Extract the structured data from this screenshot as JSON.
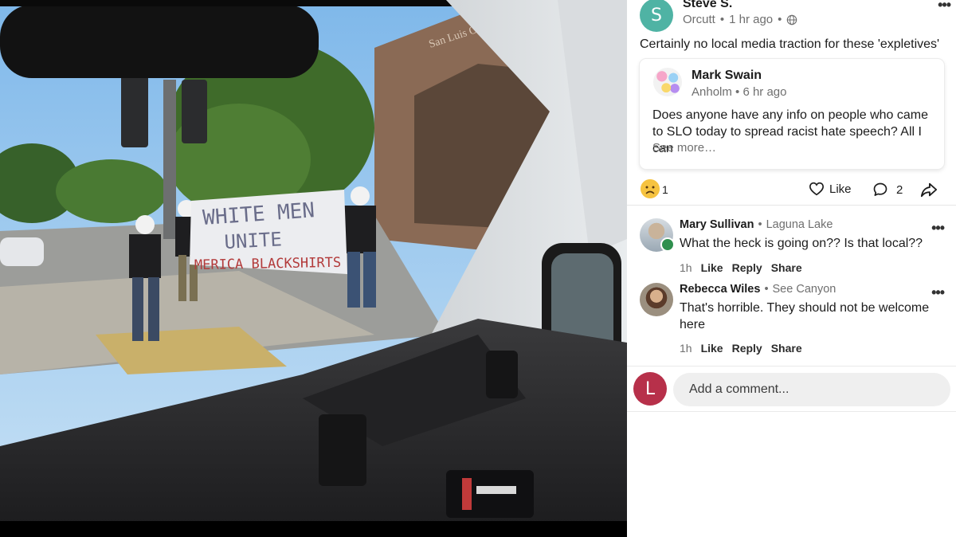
{
  "photo": {
    "banner_line1": "WHITE MEN",
    "banner_line2": "UNITE",
    "banner_line3": "MERICA BLACKSHIRTS",
    "building_sign": "San Luis Obispo"
  },
  "post": {
    "author_initial": "S",
    "author_name": "Steve S.",
    "location": "Orcutt",
    "time": "1 hr ago",
    "text": "Certainly no local media traction for these  'expletives'",
    "shared": {
      "author_name": "Mark Swain",
      "location": "Anholm",
      "time": "6 hr ago",
      "text": "Does anyone have any info on people who came to SLO today to spread racist hate speech?  All I can",
      "see_more": "See more…"
    },
    "reaction_count": "1",
    "like_label": "Like",
    "comment_count": "2"
  },
  "comments": [
    {
      "name": "Mary Sullivan",
      "location": "Laguna Lake",
      "text": "What the heck is going on?? Is that local??",
      "time": "1h",
      "like": "Like",
      "reply": "Reply",
      "share": "Share"
    },
    {
      "name": "Rebecca Wiles",
      "location": "See Canyon",
      "text": "That's horrible. They should not be welcome here",
      "time": "1h",
      "like": "Like",
      "reply": "Reply",
      "share": "Share"
    }
  ],
  "composer": {
    "user_initial": "L",
    "placeholder": "Add a comment..."
  },
  "colors": {
    "avatar_s": "#4fb3a4",
    "avatar_l": "#b7304a",
    "sky": "#8ec3ee",
    "dashboard": "#2a2a2c"
  }
}
